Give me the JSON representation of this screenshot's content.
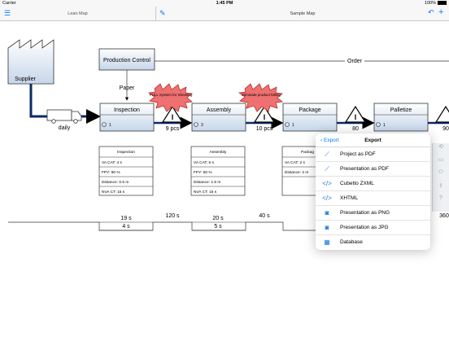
{
  "status": {
    "carrier": "Carrier",
    "time": "1:45 PM",
    "battery": "100%"
  },
  "nav": {
    "left_title": "Lean Map",
    "right_title": "Sample Map"
  },
  "diagram": {
    "supplier": "Supplier",
    "production_control": "Production Control",
    "order": "Order",
    "paper": "Paper",
    "daily": "daily",
    "kaizen1": "PULL System for Sheeting",
    "kaizen2": "Eliminate product falling",
    "processes": [
      {
        "name": "Inspection",
        "operators": "1"
      },
      {
        "name": "Assembly",
        "operators": "3"
      },
      {
        "name": "Package",
        "operators": "1"
      },
      {
        "name": "Palletize",
        "operators": "1"
      }
    ],
    "inventories": [
      "9 pcs",
      "10 pcs",
      "80",
      "90"
    ],
    "data_boxes": [
      {
        "title": "Inspection",
        "rows": [
          "VA CAT: 4 s",
          "FPY: 90 %",
          "Distance: 0.5 m",
          "NVA CT: 15 s"
        ]
      },
      {
        "title": "Assembly",
        "rows": [
          "VA CAT: 5 s",
          "FPY: 50 %",
          "Distance: 1.5 m",
          "NVA CT: 15 s"
        ]
      },
      {
        "title": "Packag",
        "rows": [
          "VA CAT: 2 s",
          "Distance: 2 m"
        ]
      }
    ],
    "timeline": {
      "top": [
        "19 s",
        "20 s"
      ],
      "bottom": [
        "4 s",
        "5 s"
      ],
      "gaps": [
        "120 s",
        "40 s"
      ],
      "end": "360"
    }
  },
  "export_menu": {
    "back": "Export",
    "title": "Export",
    "items": [
      {
        "label": "Project as PDF",
        "icon": "pdf-icon"
      },
      {
        "label": "Presentation as PDF",
        "icon": "pdf-icon"
      },
      {
        "label": "Cubetto ZXML",
        "icon": "code-icon"
      },
      {
        "label": "XHTML",
        "icon": "code-icon"
      },
      {
        "label": "Presentation as PNG",
        "icon": "camera-icon"
      },
      {
        "label": "Presentation as JPG",
        "icon": "camera-icon"
      },
      {
        "label": "Database",
        "icon": "database-icon"
      }
    ]
  }
}
